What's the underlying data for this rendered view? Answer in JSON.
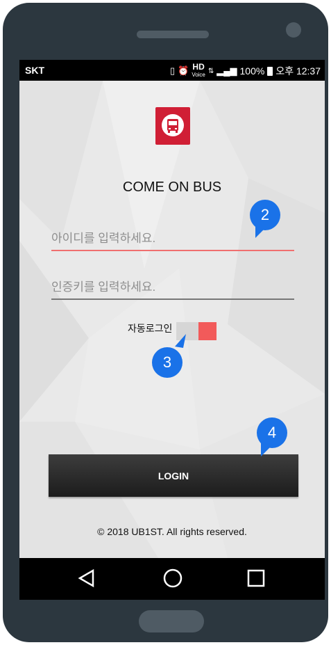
{
  "status_bar": {
    "carrier": "SKT",
    "hd_label": "HD",
    "voice_label": "Voice",
    "battery": "100%",
    "time": "오후 12:37"
  },
  "app": {
    "title": "COME ON BUS",
    "logo_icon": "bus-icon",
    "brand_color": "#d01f35"
  },
  "form": {
    "id_placeholder": "아이디를 입력하세요.",
    "key_placeholder": "인증키를 입력하세요.",
    "auto_login_label": "자동로그인",
    "auto_login_on": true,
    "login_label": "LOGIN"
  },
  "footer": {
    "copyright": "© 2018 UB1ST. All rights reserved."
  },
  "nav": {
    "icons": [
      "back-icon",
      "home-icon",
      "recents-icon"
    ]
  },
  "annotations": {
    "badge_2": "2",
    "badge_3": "3",
    "badge_4": "4",
    "badge_color": "#1a72e8"
  }
}
